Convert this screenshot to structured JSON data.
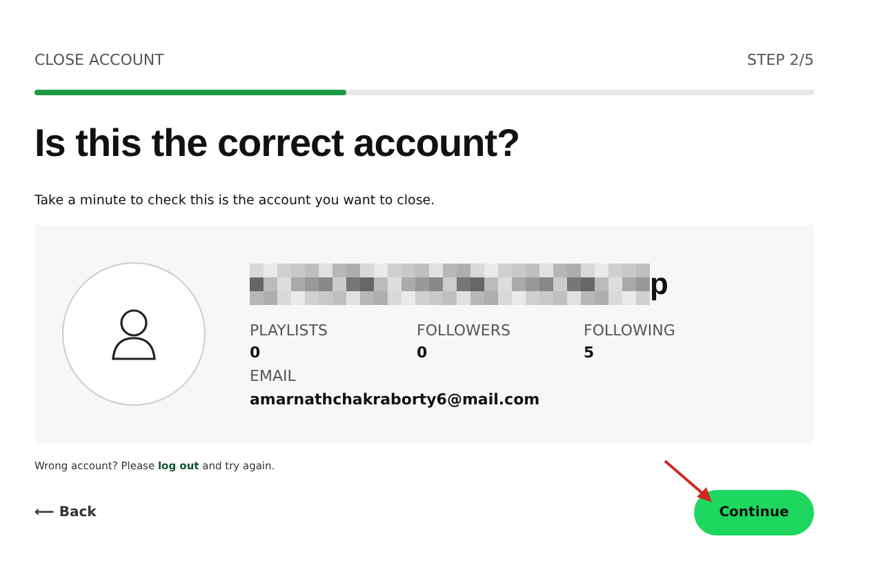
{
  "header": {
    "title": "CLOSE ACCOUNT",
    "step": "STEP 2/5"
  },
  "progress": {
    "level": 0.4
  },
  "heading": "Is this the correct account?",
  "intro": "Take a minute to check this is the account you want to close.",
  "account": {
    "name_visible_end": "p",
    "stats": [
      {
        "label": "PLAYLISTS",
        "value": "0"
      },
      {
        "label": "FOLLOWERS",
        "value": "0"
      },
      {
        "label": "FOLLOWING",
        "value": "5"
      }
    ],
    "email_label": "EMAIL",
    "email": "amarnathchakraborty6@mail.com"
  },
  "wrong_account": {
    "before": "Wrong account? Please",
    "link": "log out",
    "after": "and try again."
  },
  "back": {
    "icon": "⟵",
    "label": "Back"
  },
  "continue": {
    "label": "Continue"
  }
}
